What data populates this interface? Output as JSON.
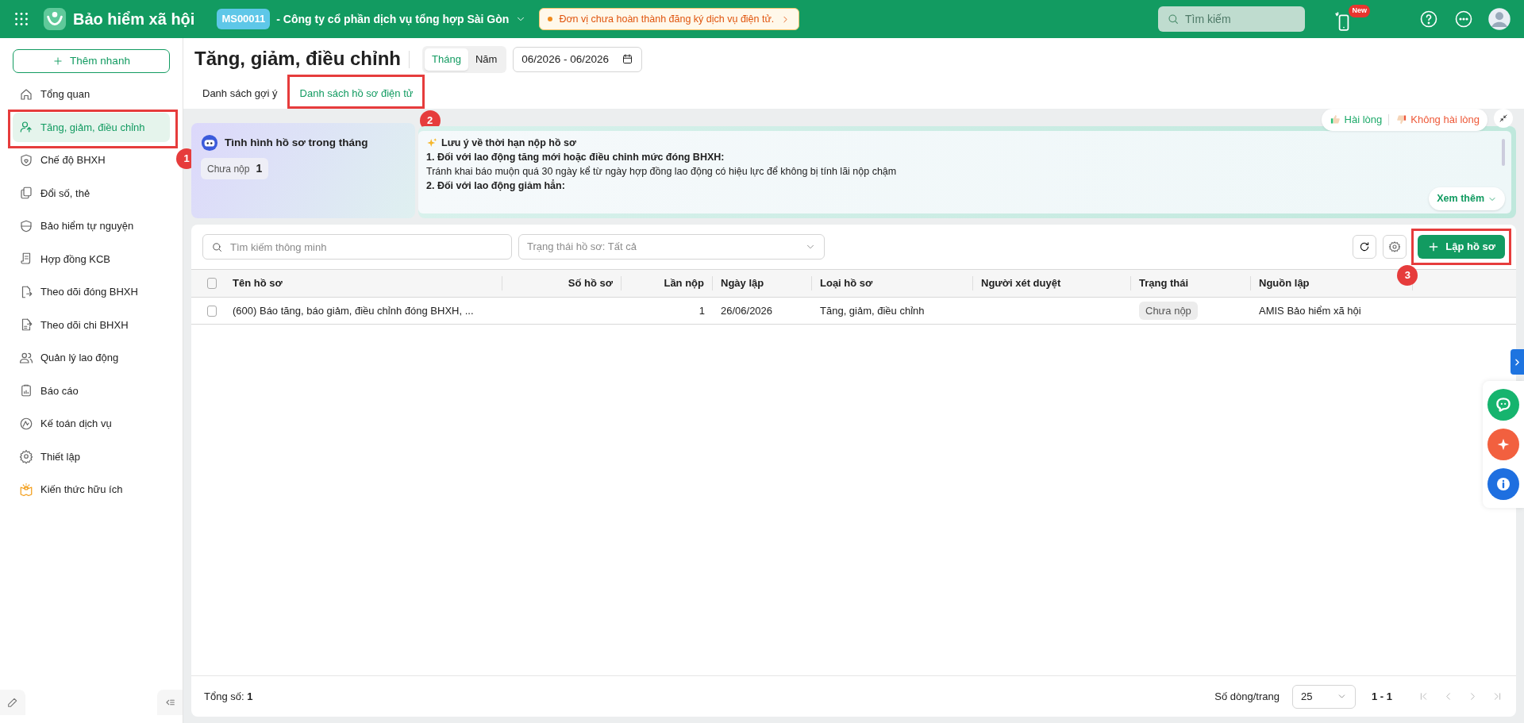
{
  "top_bar": {
    "app_title": "Bảo hiểm xã hội",
    "company_code": "MS00011",
    "company_name": "- Công ty cổ phần dịch vụ tổng hợp Sài Gòn",
    "notice": "Đơn vị chưa hoàn thành đăng ký dịch vụ điện tử.",
    "search": {
      "placeholder": "Tìm kiếm"
    },
    "new_badge": "New"
  },
  "sidebar": {
    "quick_add": "Thêm nhanh",
    "items": [
      {
        "label": "Tổng quan",
        "selected": false
      },
      {
        "label": "Tăng, giảm, điều chỉnh",
        "selected": true,
        "annotation": "1"
      },
      {
        "label": "Chế độ BHXH",
        "selected": false
      },
      {
        "label": "Đổi số, thẻ",
        "selected": false
      },
      {
        "label": "Bảo hiểm tự nguyện",
        "selected": false
      },
      {
        "label": "Hợp đồng KCB",
        "selected": false
      },
      {
        "label": "Theo dõi đóng BHXH",
        "selected": false
      },
      {
        "label": "Theo dõi chi BHXH",
        "selected": false
      },
      {
        "label": "Quản lý lao động",
        "selected": false
      },
      {
        "label": "Báo cáo",
        "selected": false
      },
      {
        "label": "Kế toán dịch vụ",
        "selected": false
      },
      {
        "label": "Thiết lập",
        "selected": false
      },
      {
        "label": "Kiến thức hữu ích",
        "selected": false
      }
    ]
  },
  "page_header": {
    "title": "Tăng, giảm, điều chỉnh",
    "period_toggle": [
      {
        "label": "Tháng",
        "selected": true
      },
      {
        "label": "Năm",
        "selected": false
      }
    ],
    "date_range": "06/2026 - 06/2026"
  },
  "tabs": [
    {
      "label": "Danh sách gợi ý",
      "selected": false
    },
    {
      "label": "Danh sách hồ sơ điện tử",
      "selected": true,
      "annotation": "2"
    }
  ],
  "summary_card": {
    "title": "Tình hình hồ sơ trong tháng",
    "stat_label": "Chưa nộp",
    "stat_value": "1"
  },
  "notice_panel": {
    "lines": [
      {
        "kind": "title",
        "text": "Lưu ý về thời hạn nộp hồ sơ"
      },
      {
        "kind": "heading",
        "text": "1. Đối với lao động tăng mới hoặc điều chỉnh mức đóng BHXH:"
      },
      {
        "kind": "body",
        "text": "Tránh khai báo muộn quá 30 ngày kể từ ngày hợp đồng lao động có hiệu lực để không bị tính lãi nộp chậm"
      },
      {
        "kind": "heading",
        "text": "2. Đối với lao động giảm hẳn:"
      }
    ],
    "more_button": "Xem thêm"
  },
  "feedback": {
    "like": "Hài lòng",
    "dislike": "Không hài lòng"
  },
  "table": {
    "search": {
      "placeholder": "Tìm kiếm thông minh"
    },
    "status_filter": "Trạng thái hồ sơ: Tất cả",
    "create_button": {
      "label": "Lập hồ sơ",
      "annotation": "3"
    },
    "header_checked": false,
    "columns": [
      {
        "label": "Tên hồ sơ",
        "kind": "text"
      },
      {
        "label": "Số hồ sơ",
        "kind": "number"
      },
      {
        "label": "Lần nộp",
        "kind": "number"
      },
      {
        "label": "Ngày lập",
        "kind": "text"
      },
      {
        "label": "Loại hồ sơ",
        "kind": "text"
      },
      {
        "label": "Người xét duyệt",
        "kind": "text"
      },
      {
        "label": "Trạng thái",
        "kind": "status"
      },
      {
        "label": "Nguồn lập",
        "kind": "text"
      }
    ],
    "rows": [
      {
        "checked": false,
        "cells": [
          "(600) Báo tăng, báo giảm, điều chỉnh đóng BHXH, ...",
          "",
          "1",
          "26/06/2026",
          "Tăng, giảm, điều chỉnh",
          "",
          "Chưa nộp",
          "AMIS Bảo hiểm xã hội"
        ]
      }
    ]
  },
  "footer": {
    "total": "Tổng số: **1**",
    "rows_per_page_label": "Số dòng/trang",
    "rows_per_page": "25",
    "range": "1 - 1"
  }
}
